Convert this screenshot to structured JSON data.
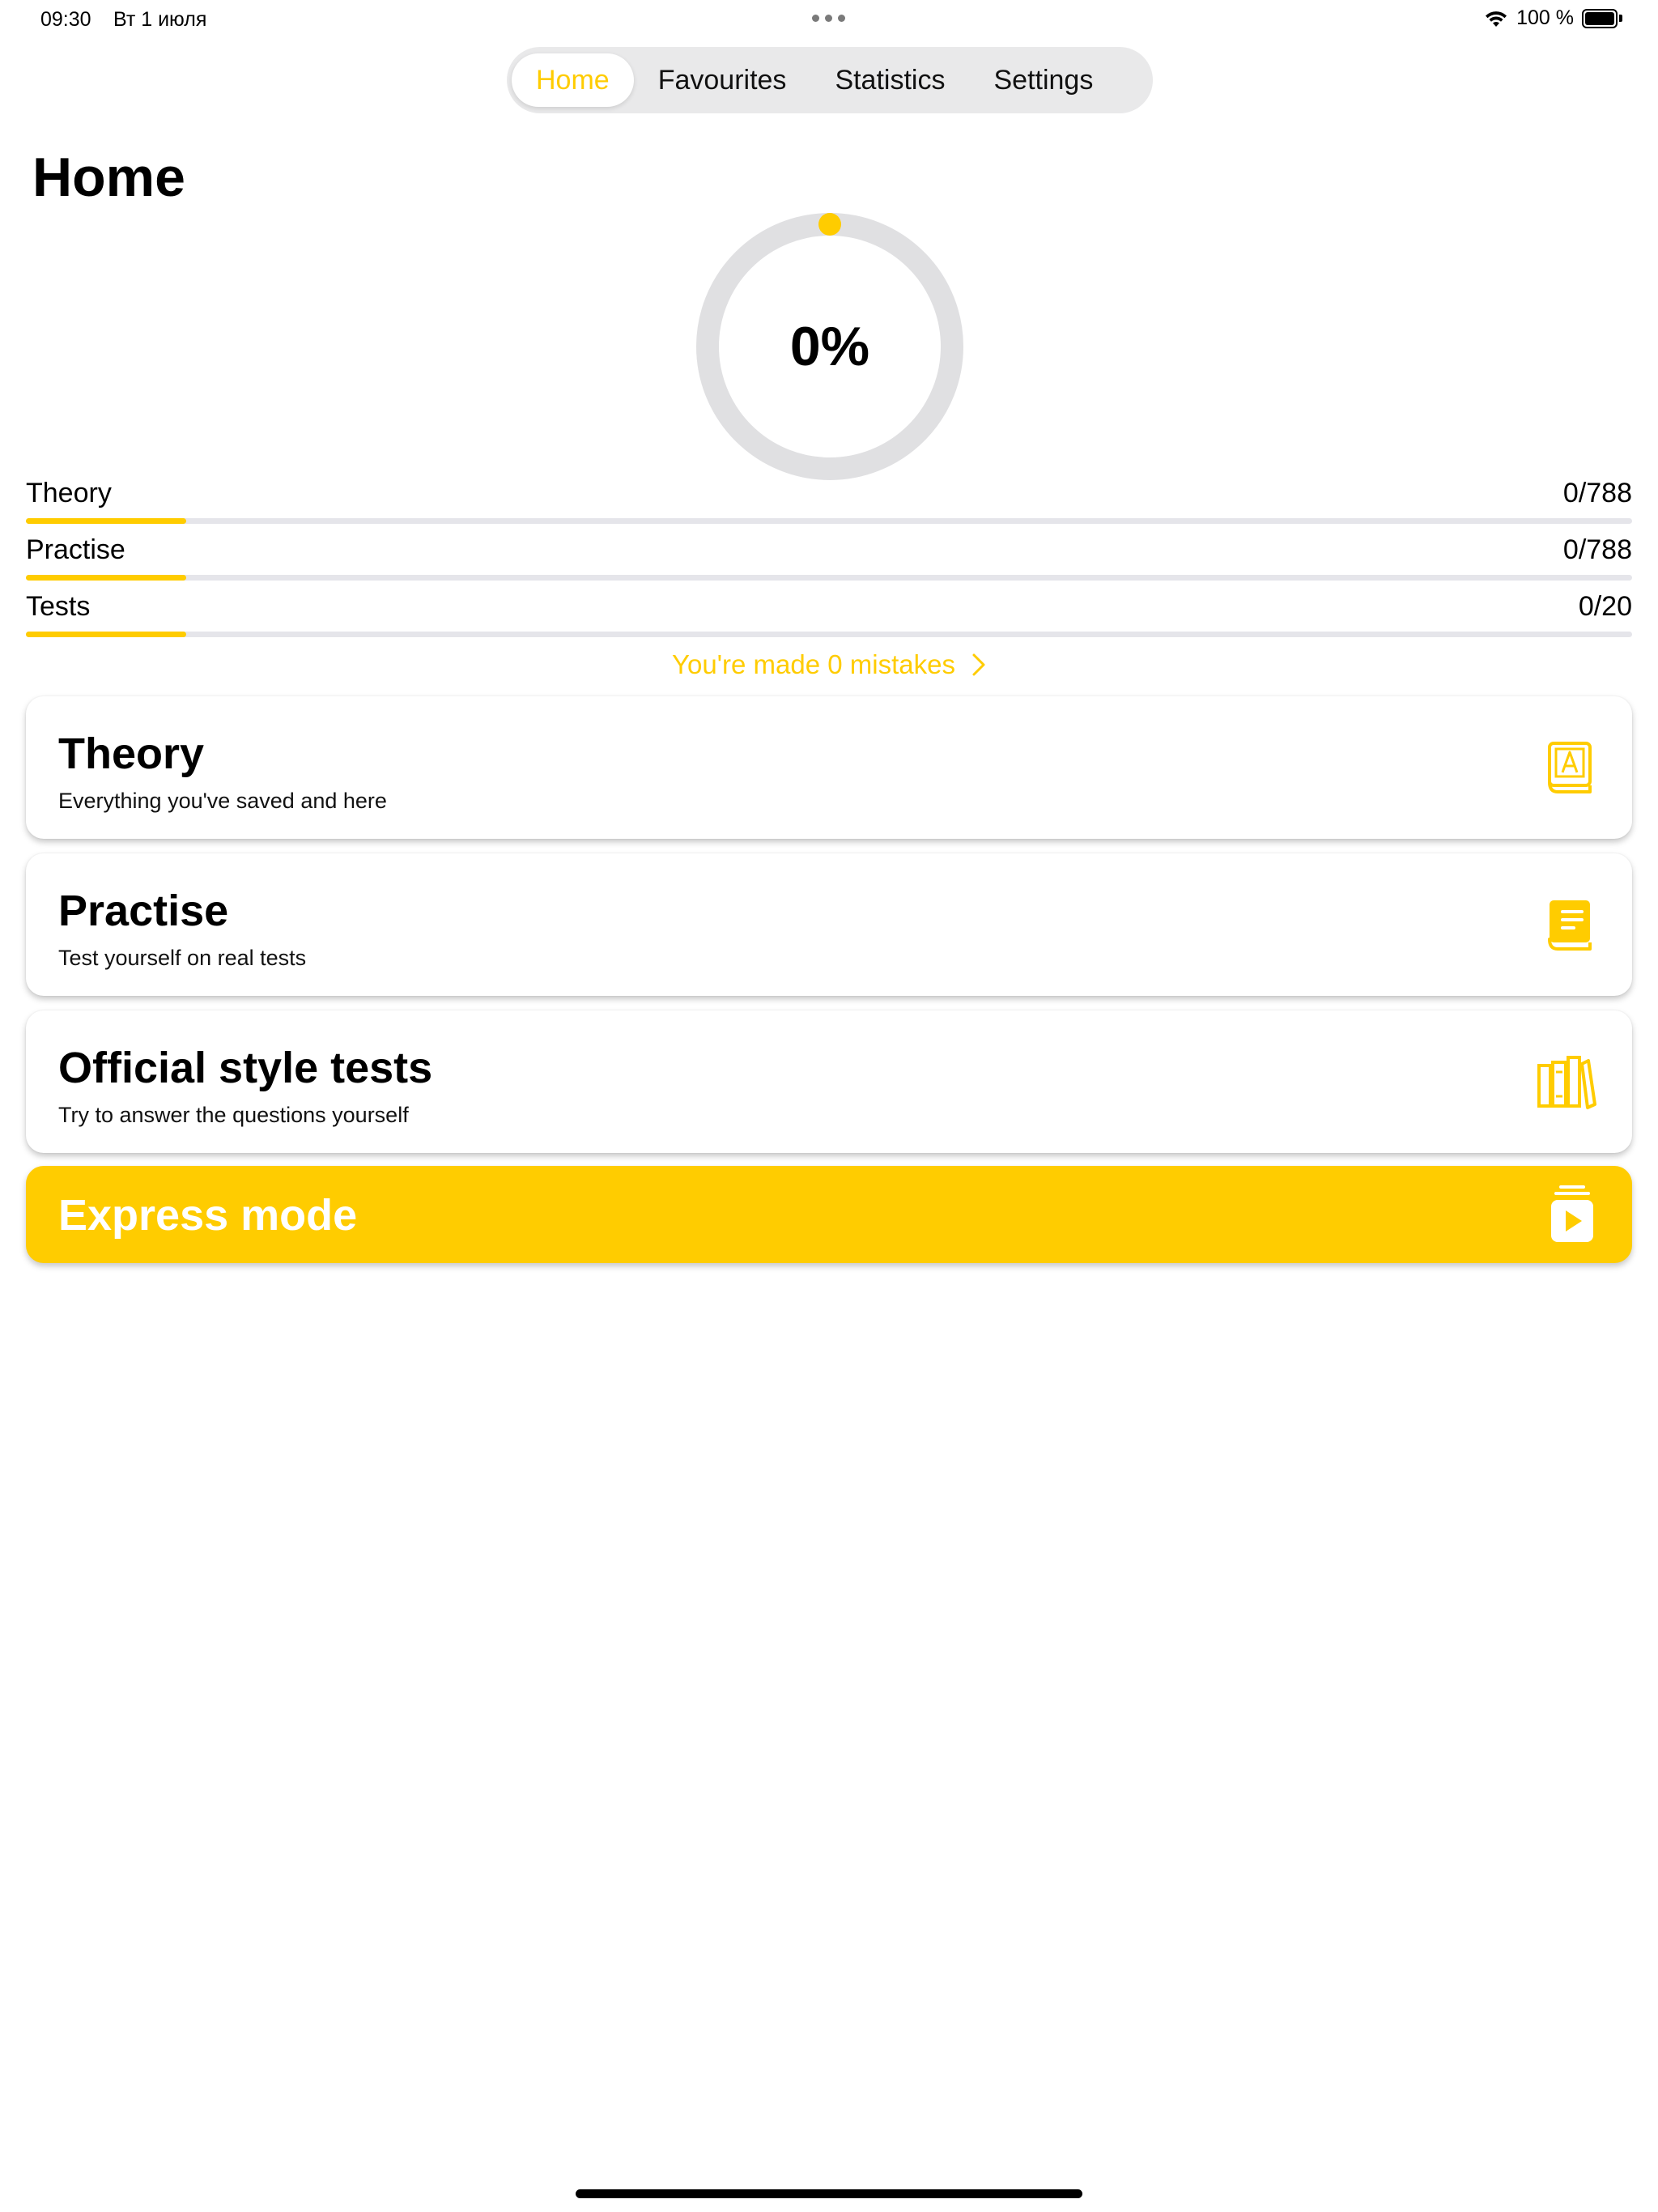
{
  "status_bar": {
    "time": "09:30",
    "date": "Вт 1 июля",
    "battery": "100 %"
  },
  "nav": {
    "tabs": [
      {
        "label": "Home",
        "active": true
      },
      {
        "label": "Favourites",
        "active": false
      },
      {
        "label": "Statistics",
        "active": false
      },
      {
        "label": "Settings",
        "active": false
      }
    ]
  },
  "page": {
    "title": "Home"
  },
  "overall_progress": {
    "label": "0%",
    "percent": 0
  },
  "progress": [
    {
      "label": "Theory",
      "value": "0/788",
      "fill_fraction": 0.1
    },
    {
      "label": "Practise",
      "value": "0/788",
      "fill_fraction": 0.1
    },
    {
      "label": "Tests",
      "value": "0/20",
      "fill_fraction": 0.1
    }
  ],
  "mistakes": {
    "label": "You're made 0 mistakes"
  },
  "cards": [
    {
      "title": "Theory",
      "subtitle": "Everything you've saved and here",
      "icon": "theory-book-icon"
    },
    {
      "title": "Practise",
      "subtitle": "Test yourself on real tests",
      "icon": "practise-book-icon"
    },
    {
      "title": "Official style tests",
      "subtitle": "Try to answer the questions yourself",
      "icon": "books-shelf-icon"
    }
  ],
  "express": {
    "title": "Express mode",
    "icon": "play-stack-icon"
  },
  "colors": {
    "accent": "#ffcc00",
    "track": "#e5e5ea",
    "segmented_bg": "#e9e9ea"
  }
}
